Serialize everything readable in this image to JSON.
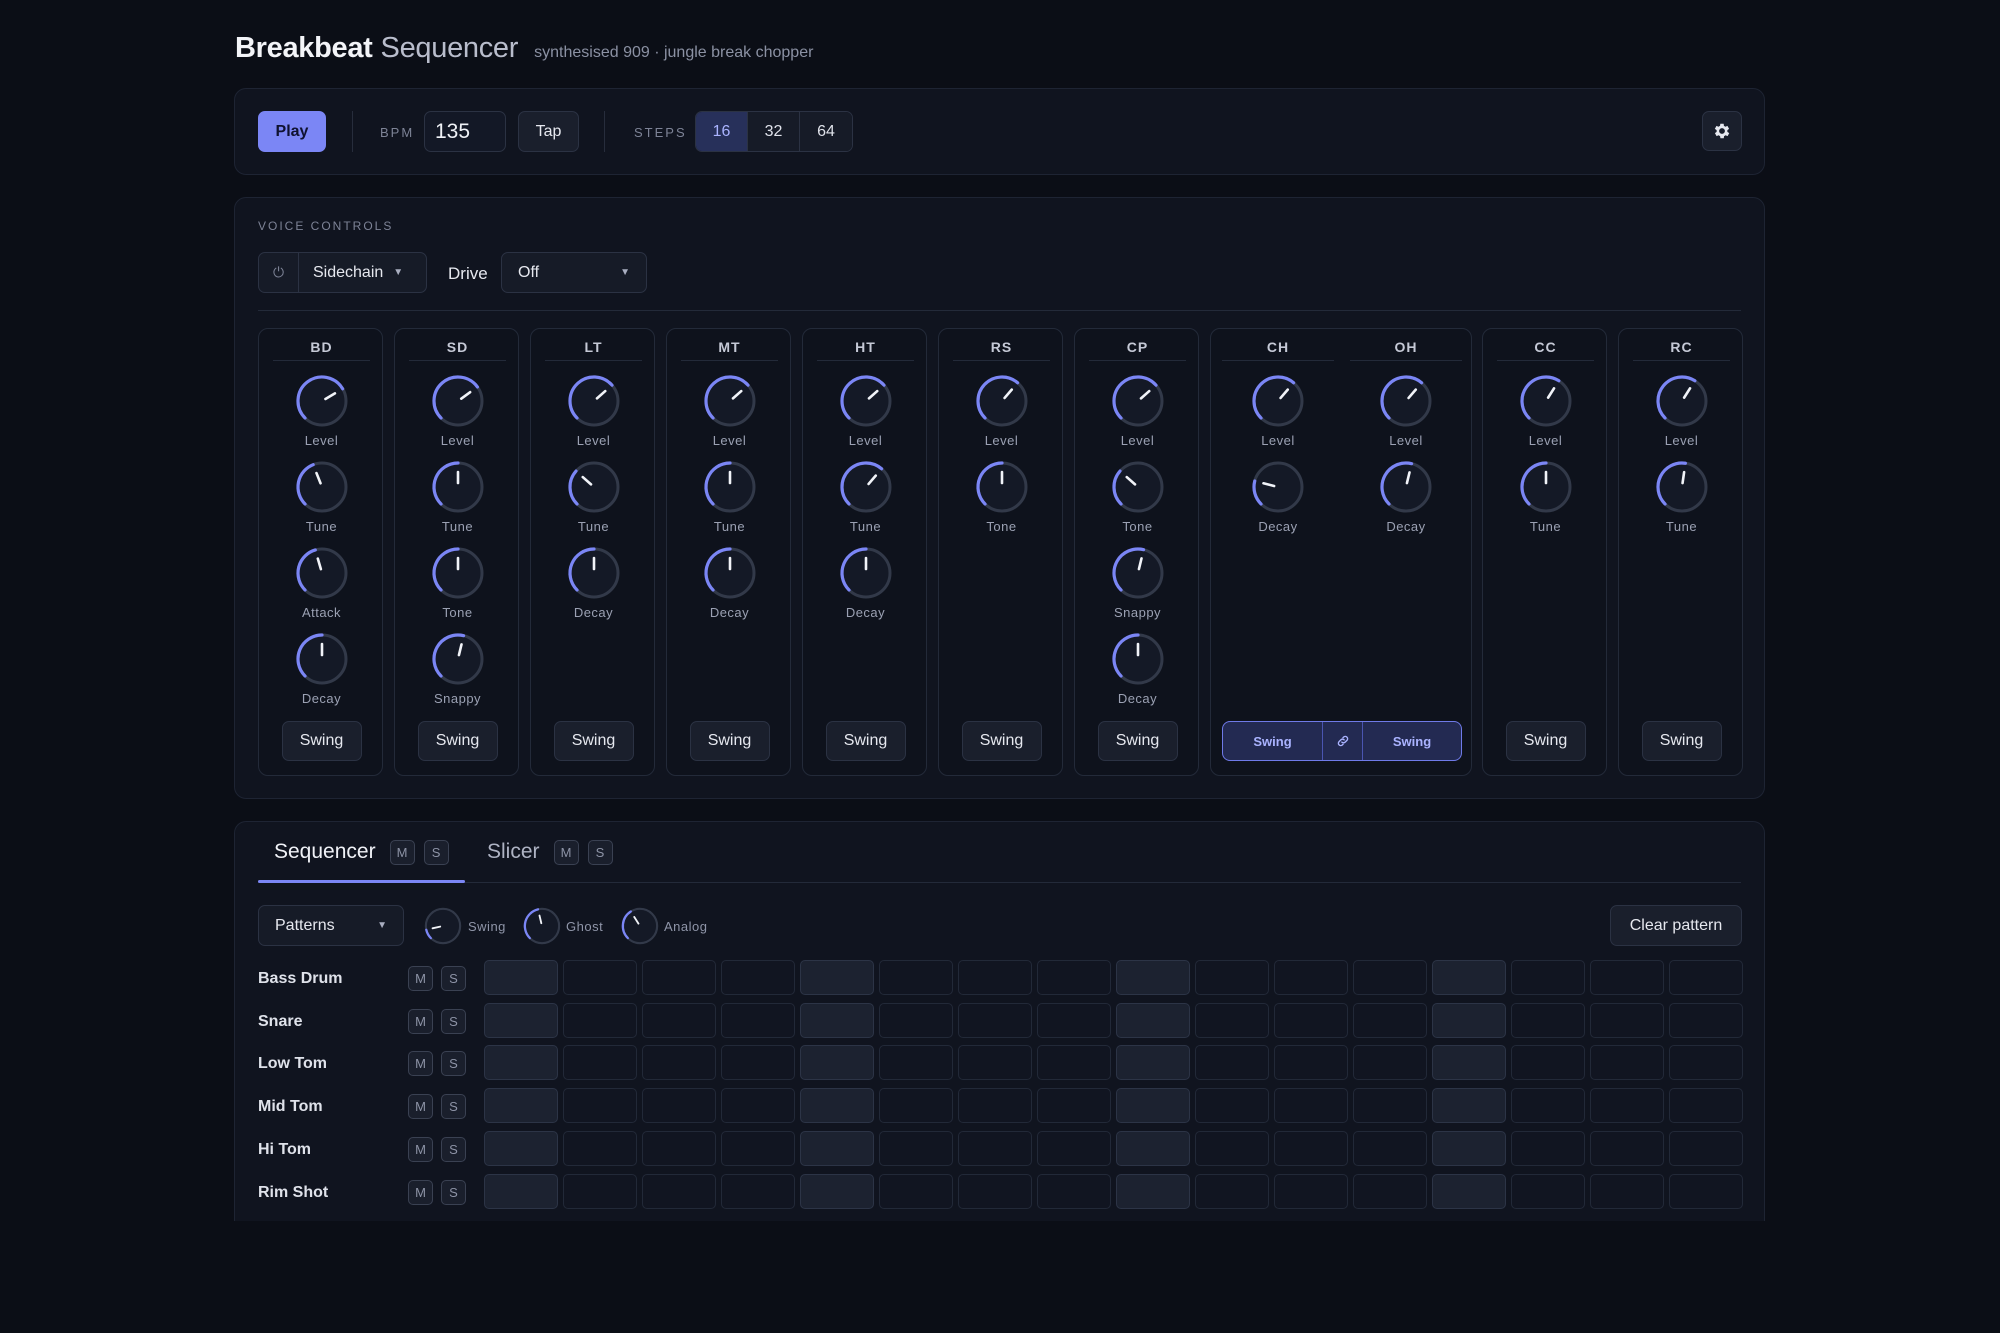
{
  "header": {
    "title_bold": "Breakbeat",
    "title_light": "Sequencer",
    "subtitle": "synthesised 909 · jungle break chopper"
  },
  "transport": {
    "play_label": "Play",
    "bpm_label": "BPM",
    "bpm_value": "135",
    "tap_label": "Tap",
    "steps_label": "STEPS",
    "steps_options": [
      "16",
      "32",
      "64"
    ],
    "steps_selected": "16",
    "settings_icon": "gear-icon"
  },
  "voice_controls": {
    "section_label": "VOICE CONTROLS",
    "sidechain_label": "Sidechain",
    "power_icon": "power-icon",
    "drive_label": "Drive",
    "drive_value": "Off",
    "voices": [
      {
        "name": "BD",
        "swing": "Swing",
        "knobs": [
          {
            "label": "Level",
            "value": 0.72
          },
          {
            "label": "Tune",
            "value": 0.42
          },
          {
            "label": "Attack",
            "value": 0.44
          },
          {
            "label": "Decay",
            "value": 0.5
          }
        ]
      },
      {
        "name": "SD",
        "swing": "Swing",
        "knobs": [
          {
            "label": "Level",
            "value": 0.7
          },
          {
            "label": "Tune",
            "value": 0.5
          },
          {
            "label": "Tone",
            "value": 0.5
          },
          {
            "label": "Snappy",
            "value": 0.55
          }
        ]
      },
      {
        "name": "LT",
        "swing": "Swing",
        "knobs": [
          {
            "label": "Level",
            "value": 0.68
          },
          {
            "label": "Tune",
            "value": 0.32
          },
          {
            "label": "Decay",
            "value": 0.5
          }
        ]
      },
      {
        "name": "MT",
        "swing": "Swing",
        "knobs": [
          {
            "label": "Level",
            "value": 0.68
          },
          {
            "label": "Tune",
            "value": 0.5
          },
          {
            "label": "Decay",
            "value": 0.5
          }
        ]
      },
      {
        "name": "HT",
        "swing": "Swing",
        "knobs": [
          {
            "label": "Level",
            "value": 0.68
          },
          {
            "label": "Tune",
            "value": 0.65
          },
          {
            "label": "Decay",
            "value": 0.5
          }
        ]
      },
      {
        "name": "RS",
        "swing": "Swing",
        "knobs": [
          {
            "label": "Level",
            "value": 0.65
          },
          {
            "label": "Tone",
            "value": 0.5
          }
        ]
      },
      {
        "name": "CP",
        "swing": "Swing",
        "knobs": [
          {
            "label": "Level",
            "value": 0.68
          },
          {
            "label": "Tone",
            "value": 0.32
          },
          {
            "label": "Snappy",
            "value": 0.55
          },
          {
            "label": "Decay",
            "value": 0.5
          }
        ]
      },
      {
        "name": "CC",
        "swing": "Swing",
        "knobs": [
          {
            "label": "Level",
            "value": 0.62
          },
          {
            "label": "Tune",
            "value": 0.5
          }
        ]
      },
      {
        "name": "RC",
        "swing": "Swing",
        "knobs": [
          {
            "label": "Level",
            "value": 0.62
          },
          {
            "label": "Tune",
            "value": 0.53
          }
        ]
      }
    ],
    "hats": {
      "voices": [
        {
          "name": "CH",
          "knobs": [
            {
              "label": "Level",
              "value": 0.65
            },
            {
              "label": "Decay",
              "value": 0.22
            }
          ]
        },
        {
          "name": "OH",
          "knobs": [
            {
              "label": "Level",
              "value": 0.65
            },
            {
              "label": "Decay",
              "value": 0.55
            }
          ]
        }
      ],
      "swing_left": "Swing",
      "swing_right": "Swing",
      "link_icon": "link-icon"
    }
  },
  "sequencer": {
    "tabs": [
      {
        "label": "Sequencer",
        "mute": "M",
        "solo": "S"
      },
      {
        "label": "Slicer",
        "mute": "M",
        "solo": "S"
      }
    ],
    "patterns_label": "Patterns",
    "macros": [
      {
        "label": "Swing",
        "value": 0.12
      },
      {
        "label": "Ghost",
        "value": 0.45
      },
      {
        "label": "Analog",
        "value": 0.38
      }
    ],
    "clear_label": "Clear pattern",
    "rows": [
      {
        "name": "Bass Drum",
        "mute": "M",
        "solo": "S"
      },
      {
        "name": "Snare",
        "mute": "M",
        "solo": "S"
      },
      {
        "name": "Low Tom",
        "mute": "M",
        "solo": "S"
      },
      {
        "name": "Mid Tom",
        "mute": "M",
        "solo": "S"
      },
      {
        "name": "Hi Tom",
        "mute": "M",
        "solo": "S"
      },
      {
        "name": "Rim Shot",
        "mute": "M",
        "solo": "S"
      }
    ],
    "step_count": 16
  },
  "colors": {
    "accent": "#7b86f5",
    "background": "#0b0e16",
    "panel": "#10141f"
  }
}
